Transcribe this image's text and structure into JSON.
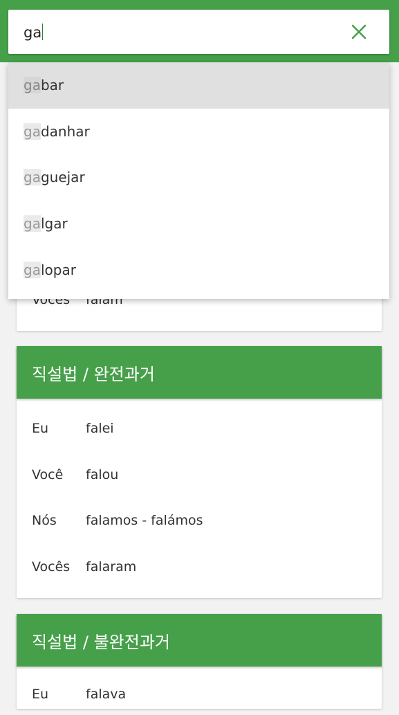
{
  "search": {
    "query": "ga",
    "suggestions": [
      {
        "match": "ga",
        "rest": "bar"
      },
      {
        "match": "ga",
        "rest": "danhar"
      },
      {
        "match": "ga",
        "rest": "guejar"
      },
      {
        "match": "ga",
        "rest": "lgar"
      },
      {
        "match": "ga",
        "rest": "lopar"
      }
    ]
  },
  "card_hidden": {
    "rows": [
      {
        "pronoun": "Vocês",
        "form": "falam"
      }
    ]
  },
  "card_perfect": {
    "title": "직설법 / 완전과거",
    "rows": [
      {
        "pronoun": "Eu",
        "form": "falei"
      },
      {
        "pronoun": "Você",
        "form": "falou"
      },
      {
        "pronoun": "Nós",
        "form": "falamos - falámos"
      },
      {
        "pronoun": "Vocês",
        "form": "falaram"
      }
    ]
  },
  "card_imperfect": {
    "title": "직설법 / 불완전과거",
    "rows": [
      {
        "pronoun": "Eu",
        "form": "falava"
      }
    ]
  },
  "colors": {
    "accent": "#46a04a",
    "highlight_bg": "#e0e0e0"
  }
}
